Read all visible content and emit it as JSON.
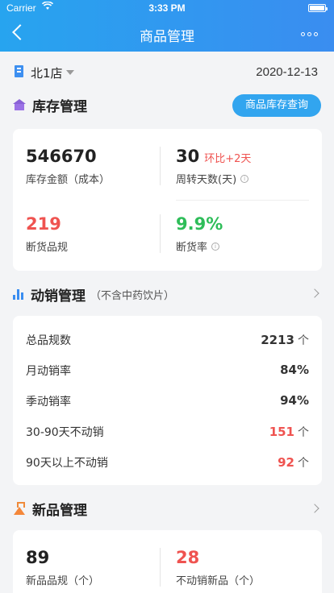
{
  "status_bar": {
    "carrier": "Carrier",
    "time": "3:33 PM"
  },
  "nav": {
    "title": "商品管理"
  },
  "store": {
    "name": "北1店",
    "date": "2020-12-13"
  },
  "inventory": {
    "title": "库存管理",
    "query_button": "商品库存查询",
    "amount_value": "546670",
    "amount_label": "库存金额（成本）",
    "turnover_value": "30",
    "turnover_ratio": "环比+2天",
    "turnover_label": "周转天数(天)",
    "out_value": "219",
    "out_label": "断货品规",
    "out_rate_value": "9.9%",
    "out_rate_label": "断货率",
    "colors": {
      "red": "#ef5350",
      "green": "#2ebd59",
      "accent": "#32a5ef"
    }
  },
  "movement": {
    "title": "动销管理",
    "subtitle": "（不含中药饮片）",
    "rows": [
      {
        "name": "总品规数",
        "value": "2213",
        "unit": "个"
      },
      {
        "name": "月动销率",
        "value": "84%",
        "unit": ""
      },
      {
        "name": "季动销率",
        "value": "94%",
        "unit": ""
      },
      {
        "name": "30-90天不动销",
        "value": "151",
        "unit": "个"
      },
      {
        "name": "90天以上不动销",
        "value": "92",
        "unit": "个"
      }
    ]
  },
  "new_products": {
    "title": "新品管理",
    "count_value": "89",
    "count_label": "新品品规（个）",
    "stagnant_value": "28",
    "stagnant_label": "不动销新品（个）"
  }
}
